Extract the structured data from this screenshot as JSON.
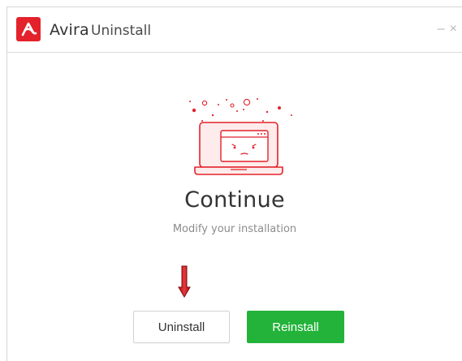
{
  "window": {
    "brand": "Avira",
    "title": "Uninstall",
    "minimize_glyph": "–",
    "close_glyph": "×"
  },
  "main": {
    "heading": "Continue",
    "subheading": "Modify your installation",
    "illustration_icon": "sad-laptop-illustration",
    "annotation_icon": "red-down-arrow-icon"
  },
  "actions": {
    "uninstall_label": "Uninstall",
    "reinstall_label": "Reinstall"
  },
  "colors": {
    "brand_red": "#e3222b",
    "primary_green": "#23b33a",
    "text_dark": "#333333",
    "text_muted": "#8c8c8c"
  }
}
